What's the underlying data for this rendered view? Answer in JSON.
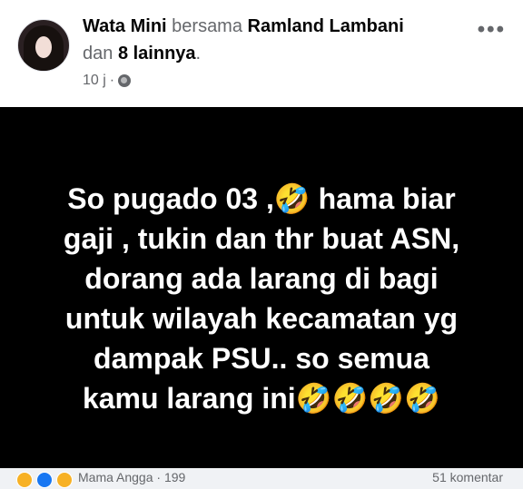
{
  "header": {
    "author": "Wata Mini",
    "with_text": "bersama",
    "tagged": "Ramland Lambani",
    "and_text": "dan",
    "others": "8 lainnya",
    "period": ".",
    "time": "10 j",
    "separator": "·",
    "privacy_icon": "globe-icon",
    "more_icon": "more-options-icon"
  },
  "post": {
    "lines": [
      "So pugado 03 ,🤣 hama biar",
      "gaji , tukin dan thr buat ASN,",
      "dorang ada larang di bagi",
      "untuk wilayah kecamatan yg",
      "dampak PSU.. so semua",
      "kamu larang ini🤣🤣🤣🤣"
    ],
    "background": "#000000",
    "text_color": "#ffffff"
  },
  "footer": {
    "reactions_text": "Mama Angga · 199",
    "comments_text": "51 komentar",
    "reaction_icons": [
      "haha-icon",
      "like-icon",
      "haha-icon"
    ]
  }
}
